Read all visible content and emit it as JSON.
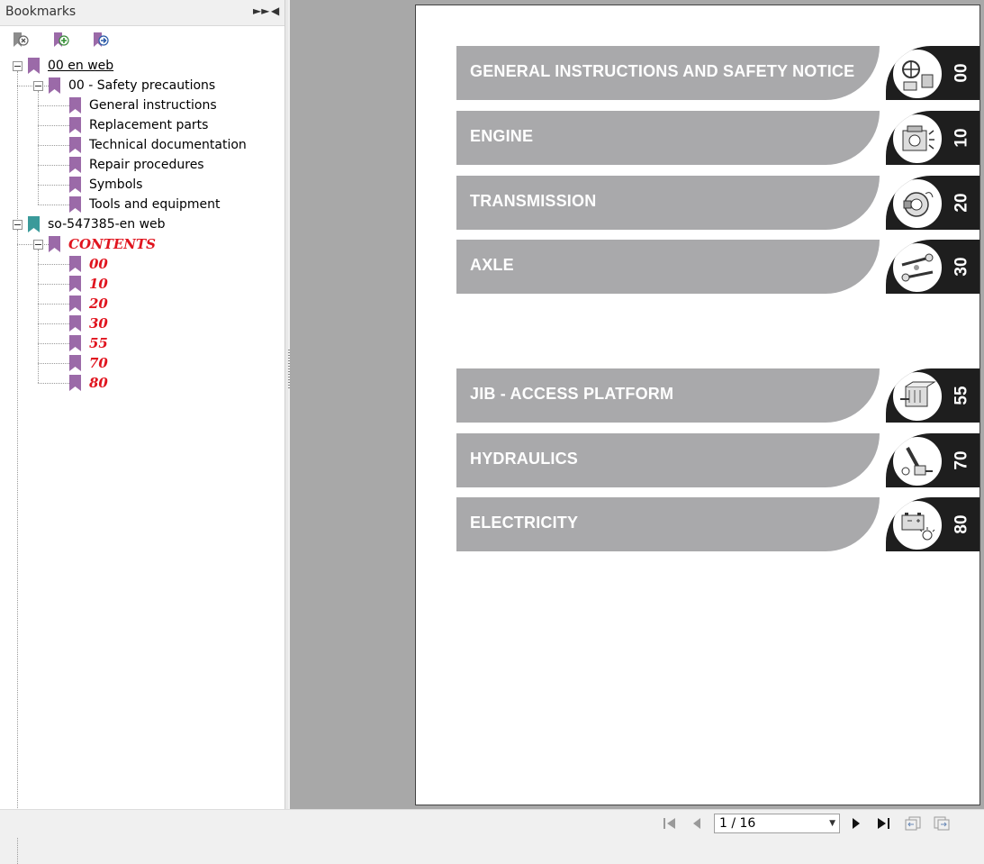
{
  "panel": {
    "title": "Bookmarks",
    "expand_icon": "double-chevron-right-icon",
    "collapse_icon": "triangle-left-icon",
    "toolbar": [
      {
        "icon": "delete-bookmark-icon"
      },
      {
        "icon": "add-bookmark-icon"
      },
      {
        "icon": "goto-bookmark-icon"
      }
    ]
  },
  "tree": [
    {
      "label": "00 en web",
      "level": 0,
      "expandable": true,
      "underline": true,
      "color": "purple"
    },
    {
      "label": "00 - Safety precautions",
      "level": 1,
      "expandable": true,
      "color": "purple"
    },
    {
      "label": "General instructions",
      "level": 2,
      "color": "purple"
    },
    {
      "label": "Replacement parts",
      "level": 2,
      "color": "purple"
    },
    {
      "label": "Technical documentation",
      "level": 2,
      "color": "purple"
    },
    {
      "label": "Repair procedures",
      "level": 2,
      "color": "purple"
    },
    {
      "label": "Symbols",
      "level": 2,
      "color": "purple"
    },
    {
      "label": "Tools and equipment",
      "level": 2,
      "color": "purple"
    },
    {
      "label": "so-547385-en web",
      "level": 0,
      "expandable": true,
      "color": "teal"
    },
    {
      "label": "CONTENTS",
      "level": 1,
      "expandable": true,
      "red": true,
      "color": "purple"
    },
    {
      "label": "00",
      "level": 2,
      "red": true,
      "color": "purple"
    },
    {
      "label": "10",
      "level": 2,
      "red": true,
      "color": "purple"
    },
    {
      "label": "20",
      "level": 2,
      "red": true,
      "color": "purple"
    },
    {
      "label": "30",
      "level": 2,
      "red": true,
      "color": "purple"
    },
    {
      "label": "55",
      "level": 2,
      "red": true,
      "color": "purple"
    },
    {
      "label": "70",
      "level": 2,
      "red": true,
      "color": "purple"
    },
    {
      "label": "80",
      "level": 2,
      "red": true,
      "color": "purple"
    }
  ],
  "colors": {
    "bookmark_purple": "#9b6aa8",
    "bookmark_teal": "#3a9a9a",
    "red_text": "#e0141e",
    "section_bar": "#a9a9ab",
    "section_dark": "#1e1e1e",
    "viewer_bg": "#a8a8a8"
  },
  "sections": [
    {
      "title": "GENERAL INSTRUCTIONS AND SAFETY NOTICE",
      "number": "00",
      "icon": "tools-icon"
    },
    {
      "title": "ENGINE",
      "number": "10",
      "icon": "engine-icon"
    },
    {
      "title": "TRANSMISSION",
      "number": "20",
      "icon": "transmission-icon"
    },
    {
      "title": "AXLE",
      "number": "30",
      "icon": "axle-icon"
    },
    {
      "title": "JIB - ACCESS PLATFORM",
      "number": "55",
      "icon": "jib-icon"
    },
    {
      "title": "HYDRAULICS",
      "number": "70",
      "icon": "hydraulics-icon"
    },
    {
      "title": "ELECTRICITY",
      "number": "80",
      "icon": "battery-icon"
    }
  ],
  "navigation": {
    "page_indicator": "1 / 16",
    "buttons": [
      {
        "icon": "first-page-icon"
      },
      {
        "icon": "previous-page-icon"
      },
      {
        "icon": "next-page-icon"
      },
      {
        "icon": "last-page-icon"
      },
      {
        "icon": "previous-view-icon"
      },
      {
        "icon": "next-view-icon"
      }
    ]
  }
}
